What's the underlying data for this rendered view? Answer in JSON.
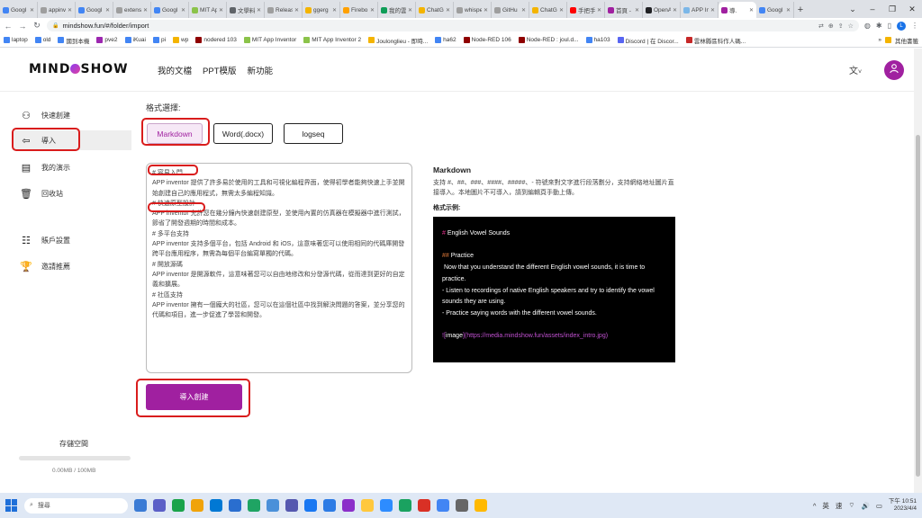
{
  "browser": {
    "tabs": [
      {
        "label": "Googl",
        "color": "#4285f4",
        "active": false
      },
      {
        "label": "appinv",
        "color": "#9e9e9e",
        "active": false
      },
      {
        "label": "Googl",
        "color": "#4285f4",
        "active": false
      },
      {
        "label": "extens",
        "color": "#9e9e9e",
        "active": false
      },
      {
        "label": "Googl",
        "color": "#4285f4",
        "active": false
      },
      {
        "label": "MIT Ap",
        "color": "#8bc34a",
        "active": false
      },
      {
        "label": "文學料",
        "color": "#5f6368",
        "active": false
      },
      {
        "label": "Releas",
        "color": "#9e9e9e",
        "active": false
      },
      {
        "label": "ggerg",
        "color": "#f4b400",
        "active": false
      },
      {
        "label": "Firebo",
        "color": "#ffa000",
        "active": false
      },
      {
        "label": "我的雲",
        "color": "#0f9d58",
        "active": false
      },
      {
        "label": "ChatG",
        "color": "#f4b400",
        "active": false
      },
      {
        "label": "whispe",
        "color": "#9e9e9e",
        "active": false
      },
      {
        "label": "GitHu",
        "color": "#9e9e9e",
        "active": false
      },
      {
        "label": "ChatG",
        "color": "#f4b400",
        "active": false
      },
      {
        "label": "手把手",
        "color": "#ff0000",
        "active": false
      },
      {
        "label": "首頁 -",
        "color": "#a020a0",
        "active": false
      },
      {
        "label": "OpenA",
        "color": "#202124",
        "active": false
      },
      {
        "label": "APP In",
        "color": "#7bb7e8",
        "active": false
      },
      {
        "label": "導.",
        "color": "#a020a0",
        "active": true
      },
      {
        "label": "Googl",
        "color": "#4285f4",
        "active": false
      }
    ],
    "new_tab": "+",
    "url": "mindshow.fun/#/folder/import",
    "profile_initial": "L",
    "bookmarks": [
      {
        "label": "laptop",
        "color": "#4285f4"
      },
      {
        "label": "old",
        "color": "#4285f4"
      },
      {
        "label": "國到本機",
        "color": "#4285f4"
      },
      {
        "label": "pve2",
        "color": "#9c27b0"
      },
      {
        "label": "iKuai",
        "color": "#4285f4"
      },
      {
        "label": "pi",
        "color": "#4285f4"
      },
      {
        "label": "wp",
        "color": "#f4b400"
      },
      {
        "label": "nodered 103",
        "color": "#8f0000"
      },
      {
        "label": "MIT App Inventor",
        "color": "#8bc34a"
      },
      {
        "label": "MIT App Inventor 2",
        "color": "#8bc34a"
      },
      {
        "label": "Joulonglieu - 即時...",
        "color": "#f4b400"
      },
      {
        "label": "ha62",
        "color": "#4285f4"
      },
      {
        "label": "Node-RED 106",
        "color": "#8f0000"
      },
      {
        "label": "Node-RED : joul.d...",
        "color": "#8f0000"
      },
      {
        "label": "ha103",
        "color": "#4285f4"
      },
      {
        "label": "Discord | 在 Discor...",
        "color": "#5865f2"
      },
      {
        "label": "雲林縣區科作人碼...",
        "color": "#c62828"
      }
    ],
    "bookmarks_more": "»",
    "other_bookmarks": "其他書籤"
  },
  "header": {
    "logo_left": "MIND",
    "logo_right": "SHOW",
    "nav": [
      "我的文檔",
      "PPT模版",
      "新功能"
    ],
    "lang_icon": "文",
    "lang_caret": "˅",
    "avatar_icon": "person-icon"
  },
  "sidebar": {
    "items": [
      {
        "label": "快速創建",
        "icon": "⚇"
      },
      {
        "label": "導入",
        "icon": "⇦"
      },
      {
        "label": "我的演示",
        "icon": "▤"
      },
      {
        "label": "回收站",
        "icon": "🗑"
      },
      {
        "label": "賬戶設置",
        "icon": "☷"
      },
      {
        "label": "邀請推薦",
        "icon": "🏆"
      }
    ],
    "storage_label": "存儲空間",
    "storage_value": "0.00MB / 100MB",
    "storage_fraction": 0
  },
  "main": {
    "format_label": "格式選擇:",
    "formats": [
      "Markdown",
      "Word(.docx)",
      "logseq"
    ],
    "selected_format": "Markdown",
    "editor_lines": [
      "# 容易入門",
      "APP inventor 提供了許多易於使用的工具和可視化編程界面，使得初學者能夠快速上手並開始創建自己的應用程式，無需太多編程知識。",
      "# 快速原型設計",
      "APP inventor 允許您在幾分鐘內快速創建原型，並使用內置的仿真器在模擬器中進行測試，節省了開發週期的時間和成本。",
      "# 多平台支持",
      "APP inventor 支持多個平台，包括 Android 和 iOS，這意味著您可以使用相同的代碼庫開發跨平台應用程序，無需為每個平台編寫單獨的代碼。",
      "# 開放源碼",
      "APP inventor 是開源軟件，這意味著您可以自由地修改和分發源代碼，從而達到更好的自定義和擴展。",
      "# 社區支持",
      "APP inventor 擁有一個龐大的社區，您可以在這個社區中找到解決問題的答案，並分享您的代碼和項目，進一步促進了學習和開發。"
    ],
    "submit_label": "導入創建",
    "help_title": "Markdown",
    "help_desc": "支持 #、##、###、####、#####、- 符號來對文字進行段落劃分，支持網絡地址圖片直接導入。本地圖片不可導入，請到編輯頁手動上傳。",
    "example_label": "格式示例:",
    "example": {
      "h1_mark": "#",
      "h1_text": " English Vowel Sounds",
      "h2_mark": "##",
      "h2_text": " Practice",
      "para": " Now that you understand the different English vowel sounds, it is time to practice.",
      "bullet1": "- Listen to recordings of native English speakers and try to identify the vowel sounds they are using.",
      "bullet2": "- Practice saying words with the different vowel sounds.",
      "img_open": "![",
      "img_alt": "image",
      "img_mid": "](https://media.mindshow.fun/assets/index_intro.jpg",
      "img_close": ")"
    }
  },
  "taskbar": {
    "search_placeholder": "搜尋",
    "apps": [
      "#3a7bd5",
      "#5b5fc7",
      "#1aa34a",
      "#f0a30a",
      "#0078d4",
      "#2a6ecf",
      "#1fa463",
      "#4a90d9",
      "#5558af",
      "#1877f2",
      "#2c7be5",
      "#8b2fc9",
      "#ffc83d",
      "#2d8cff",
      "#1aa260",
      "#d93025",
      "#4285f4",
      "#666666",
      "#ffb900"
    ],
    "tray_caret": "^",
    "ime_lang": "英",
    "ime_mode": "速",
    "time": "下午 10:51",
    "date": "2023/4/4"
  },
  "colors": {
    "brand": "#a020a0",
    "annotation": "#d91c1c"
  }
}
